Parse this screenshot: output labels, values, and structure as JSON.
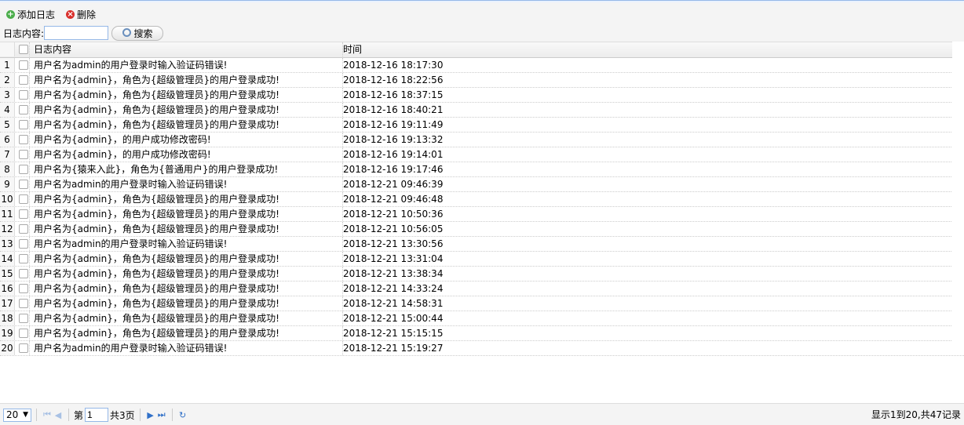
{
  "toolbar": {
    "add_label": "添加日志",
    "delete_label": "删除",
    "search_label": "日志内容:",
    "search_value": "",
    "search_button": "搜索"
  },
  "grid": {
    "columns": [
      "日志内容",
      "时间"
    ],
    "rows": [
      {
        "num": "1",
        "msg": "用户名为admin的用户登录时输入验证码错误!",
        "time": "2018-12-16 18:17:30"
      },
      {
        "num": "2",
        "msg": "用户名为{admin}，角色为{超级管理员}的用户登录成功!",
        "time": "2018-12-16 18:22:56"
      },
      {
        "num": "3",
        "msg": "用户名为{admin}，角色为{超级管理员}的用户登录成功!",
        "time": "2018-12-16 18:37:15"
      },
      {
        "num": "4",
        "msg": "用户名为{admin}，角色为{超级管理员}的用户登录成功!",
        "time": "2018-12-16 18:40:21"
      },
      {
        "num": "5",
        "msg": "用户名为{admin}，角色为{超级管理员}的用户登录成功!",
        "time": "2018-12-16 19:11:49"
      },
      {
        "num": "6",
        "msg": "用户名为{admin}，的用户成功修改密码!",
        "time": "2018-12-16 19:13:32"
      },
      {
        "num": "7",
        "msg": "用户名为{admin}，的用户成功修改密码!",
        "time": "2018-12-16 19:14:01"
      },
      {
        "num": "8",
        "msg": "用户名为{猿来入此}，角色为{普通用户}的用户登录成功!",
        "time": "2018-12-16 19:17:46"
      },
      {
        "num": "9",
        "msg": "用户名为admin的用户登录时输入验证码错误!",
        "time": "2018-12-21 09:46:39"
      },
      {
        "num": "10",
        "msg": "用户名为{admin}，角色为{超级管理员}的用户登录成功!",
        "time": "2018-12-21 09:46:48"
      },
      {
        "num": "11",
        "msg": "用户名为{admin}，角色为{超级管理员}的用户登录成功!",
        "time": "2018-12-21 10:50:36"
      },
      {
        "num": "12",
        "msg": "用户名为{admin}，角色为{超级管理员}的用户登录成功!",
        "time": "2018-12-21 10:56:05"
      },
      {
        "num": "13",
        "msg": "用户名为admin的用户登录时输入验证码错误!",
        "time": "2018-12-21 13:30:56"
      },
      {
        "num": "14",
        "msg": "用户名为{admin}，角色为{超级管理员}的用户登录成功!",
        "time": "2018-12-21 13:31:04"
      },
      {
        "num": "15",
        "msg": "用户名为{admin}，角色为{超级管理员}的用户登录成功!",
        "time": "2018-12-21 13:38:34"
      },
      {
        "num": "16",
        "msg": "用户名为{admin}，角色为{超级管理员}的用户登录成功!",
        "time": "2018-12-21 14:33:24"
      },
      {
        "num": "17",
        "msg": "用户名为{admin}，角色为{超级管理员}的用户登录成功!",
        "time": "2018-12-21 14:58:31"
      },
      {
        "num": "18",
        "msg": "用户名为{admin}，角色为{超级管理员}的用户登录成功!",
        "time": "2018-12-21 15:00:44"
      },
      {
        "num": "19",
        "msg": "用户名为{admin}，角色为{超级管理员}的用户登录成功!",
        "time": "2018-12-21 15:15:15"
      },
      {
        "num": "20",
        "msg": "用户名为admin的用户登录时输入验证码错误!",
        "time": "2018-12-21 15:19:27"
      }
    ]
  },
  "pager": {
    "page_size": "20",
    "page_prefix": "第",
    "page_value": "1",
    "page_total": "共3页",
    "info": "显示1到20,共47记录"
  },
  "colors": {
    "accent": "#95b8e7",
    "add_icon": "#4cae4c",
    "delete_icon": "#d9302c"
  }
}
